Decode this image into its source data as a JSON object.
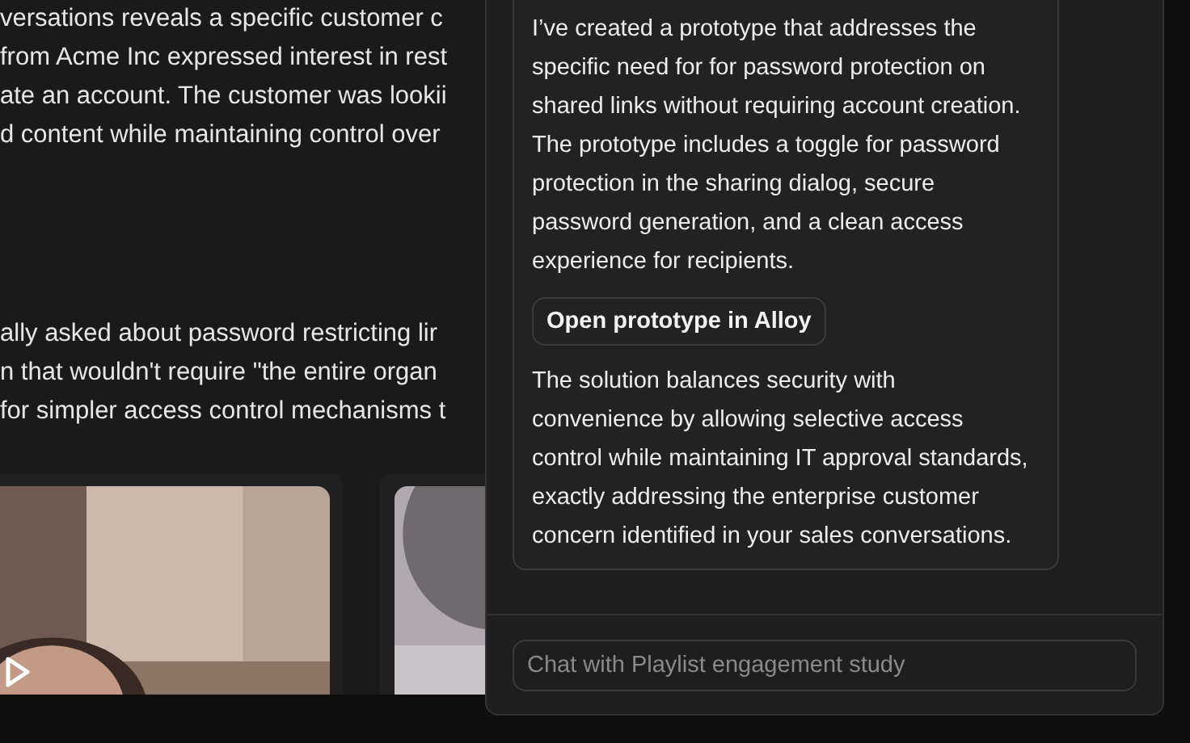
{
  "document": {
    "paragraphs": [
      {
        "lines": [
          "versations reveals a specific customer c",
          "from Acme Inc expressed interest in rest",
          "ate an account. The customer was lookii",
          "d content while maintaining control over"
        ]
      },
      {
        "lines": [
          "ally asked about password restricting lir",
          "n that wouldn't require \"the entire organ",
          "for simpler access control mechanisms t"
        ]
      }
    ]
  },
  "videos": [
    {
      "kind": "picture",
      "play_button": true
    },
    {
      "kind": "picture",
      "play_button": false
    }
  ],
  "chat": {
    "message": {
      "paragraphs": [
        "I’ve created a prototype that addresses the specific need for for password protection on shared links without requiring account creation. The prototype includes a toggle for password protection in the sharing dialog, secure password generation, and a clean access experience for recipients.",
        "The solution balances security with convenience by allowing selective access control while maintaining IT approval standards, exactly addressing the enterprise customer concern identified in your sales conversations."
      ],
      "button": "Open prototype in Alloy"
    },
    "input": {
      "placeholder": "Chat with Playlist engagement study"
    }
  }
}
